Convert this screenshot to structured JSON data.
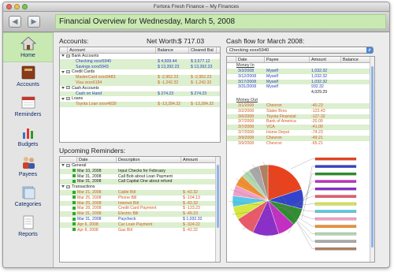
{
  "window": {
    "title": "Fortora Fresh Finance – My Finances"
  },
  "header": {
    "title": "Financial Overview for Wednesday, March 5, 2008"
  },
  "sidebar": {
    "items": [
      {
        "label": "Home",
        "icon": "house-icon",
        "active": true
      },
      {
        "label": "Accounts",
        "icon": "ledger-book-icon",
        "active": false
      },
      {
        "label": "Reminders",
        "icon": "calendar-icon",
        "active": false
      },
      {
        "label": "Budgets",
        "icon": "bar-chart-icon",
        "active": false
      },
      {
        "label": "Payees",
        "icon": "people-icon",
        "active": false
      },
      {
        "label": "Categories",
        "icon": "folders-icon",
        "active": false
      },
      {
        "label": "Reports",
        "icon": "document-icon",
        "active": false
      }
    ]
  },
  "accounts": {
    "title": "Accounts:",
    "net_worth_label": "Net Worth:",
    "net_worth": "$ 717.03",
    "columns": [
      "Account",
      "Balance",
      "Cleared Bal"
    ],
    "rows": [
      {
        "kind": "group",
        "name": "Bank Accounts",
        "balance": "",
        "cleared": ""
      },
      {
        "kind": "acct",
        "name": "Checking xxxx5940",
        "balance": "$ 4,509.44",
        "cleared": "$ 3,577.12",
        "color": "blue"
      },
      {
        "kind": "acct",
        "name": "Savings xxxx5943",
        "balance": "$ 13,392.23",
        "cleared": "$ 13,392.23",
        "color": "blue"
      },
      {
        "kind": "group",
        "name": "Credit Cards",
        "balance": "",
        "cleared": ""
      },
      {
        "kind": "acct",
        "name": "MasterCard xxxx9483",
        "balance": "$ -2,952.23",
        "cleared": "$ -2,952.23",
        "color": "red"
      },
      {
        "kind": "acct",
        "name": "Visa xxxx6184",
        "balance": "$ -1,242.32",
        "cleared": "$ -1,242.32",
        "color": "red"
      },
      {
        "kind": "group",
        "name": "Cash Accounts",
        "balance": "",
        "cleared": ""
      },
      {
        "kind": "acct",
        "name": "Cash on Hand",
        "balance": "$ 274.23",
        "cleared": "$ 274.23",
        "color": "blue"
      },
      {
        "kind": "group",
        "name": "Loans",
        "balance": "",
        "cleared": ""
      },
      {
        "kind": "acct",
        "name": "Toyota Loan xxxx4839",
        "balance": "$ -13,284.32",
        "cleared": "$ -13,284.32",
        "color": "red"
      }
    ]
  },
  "reminders": {
    "title": "Upcoming Reminders:",
    "columns": [
      "Date",
      "Description",
      "Amount"
    ],
    "rows": [
      {
        "kind": "group",
        "date": "General",
        "desc": "",
        "amount": ""
      },
      {
        "kind": "item",
        "date": "Mar 10, 2008",
        "desc": "Input Checks for February",
        "amount": "",
        "color": "black"
      },
      {
        "kind": "item",
        "date": "Mar 31, 2008",
        "desc": "Call Bob about Loan Payment",
        "amount": "",
        "color": "black"
      },
      {
        "kind": "item",
        "date": "Mar 31, 2008",
        "desc": "Call Capital One about refund",
        "amount": "",
        "color": "black"
      },
      {
        "kind": "group",
        "date": "Transactions",
        "desc": "",
        "amount": ""
      },
      {
        "kind": "item",
        "date": "Mar 21, 2008",
        "desc": "Cable Bill",
        "amount": "$ -42.32",
        "color": "red"
      },
      {
        "kind": "item",
        "date": "Mar 25, 2008",
        "desc": "Phone Bill",
        "amount": "$ -104.13",
        "color": "red"
      },
      {
        "kind": "item",
        "date": "Mar 25, 2008",
        "desc": "Internet Bill",
        "amount": "$ -42.32",
        "color": "red"
      },
      {
        "kind": "item",
        "date": "Mar 28, 2008",
        "desc": "Credit Card Payment",
        "amount": "$ -123.23",
        "color": "red"
      },
      {
        "kind": "item",
        "date": "Mar 31, 2008",
        "desc": "Electric Bill",
        "amount": "$ -49.23",
        "color": "red"
      },
      {
        "kind": "item",
        "date": "Mar 31, 2008",
        "desc": "Paycheck",
        "amount": "$ 1,032.32",
        "color": "blue"
      },
      {
        "kind": "item",
        "date": "Apr 6, 2008",
        "desc": "Car Loan Payment",
        "amount": "$ -324.22",
        "color": "red"
      },
      {
        "kind": "item",
        "date": "Apr 8, 2008",
        "desc": "Gas Bill",
        "amount": "$ -42.32",
        "color": "red"
      }
    ]
  },
  "cashflow": {
    "title": "Cash flow for March 2008:",
    "account_select": "Checking xxxx5940",
    "columns": [
      "Date",
      "Payee",
      "Amount",
      "Balance"
    ],
    "money_in_label": "Money In",
    "money_out_label": "Money Out",
    "money_in": [
      {
        "date": "3/3/2008",
        "payee": "Myself",
        "amount": "1,032.32"
      },
      {
        "date": "3/12/2008",
        "payee": "Myself",
        "amount": "1,032.32"
      },
      {
        "date": "3/17/2008",
        "payee": "Myself",
        "amount": "1,032.32"
      },
      {
        "date": "3/31/2008",
        "payee": "Myself",
        "amount": "932.32"
      }
    ],
    "money_in_total": "4,029.29",
    "money_out": [
      {
        "date": "3/1/2008",
        "payee": "Chevron",
        "amount": "-40.23"
      },
      {
        "date": "3/2/2008",
        "payee": "Stater Bros",
        "amount": "-123.43"
      },
      {
        "date": "3/6/2008",
        "payee": "Toyota Financial",
        "amount": "-127.32"
      },
      {
        "date": "3/7/2008",
        "payee": "Bank of America",
        "amount": "-20.00"
      },
      {
        "date": "3/7/2008",
        "payee": "VCA",
        "amount": "-41.00"
      },
      {
        "date": "3/7/2008",
        "payee": "Home Depot",
        "amount": "-74.23"
      },
      {
        "date": "3/9/2008",
        "payee": "Chevron",
        "amount": "-49.21"
      },
      {
        "date": "3/9/2008",
        "payee": "Chevron",
        "amount": "-65.21"
      }
    ]
  },
  "chart_data": {
    "type": "pie",
    "title": "",
    "slices": [
      {
        "value": 20,
        "color": "#e8431f"
      },
      {
        "value": 9,
        "color": "#3344cc"
      },
      {
        "value": 8,
        "color": "#2a8f2a"
      },
      {
        "value": 8,
        "color": "#c22fc2"
      },
      {
        "value": 12,
        "color": "#8a2fc8"
      },
      {
        "value": 9,
        "color": "#e85a6a"
      },
      {
        "value": 6,
        "color": "#d6e840"
      },
      {
        "value": 5,
        "color": "#54c8e8"
      },
      {
        "value": 5,
        "color": "#f0a0c8"
      },
      {
        "value": 5,
        "color": "#f09030"
      },
      {
        "value": 4,
        "color": "#b0d8b0"
      },
      {
        "value": 5,
        "color": "#a8a8a8"
      },
      {
        "value": 4,
        "color": "#b08060"
      }
    ]
  }
}
